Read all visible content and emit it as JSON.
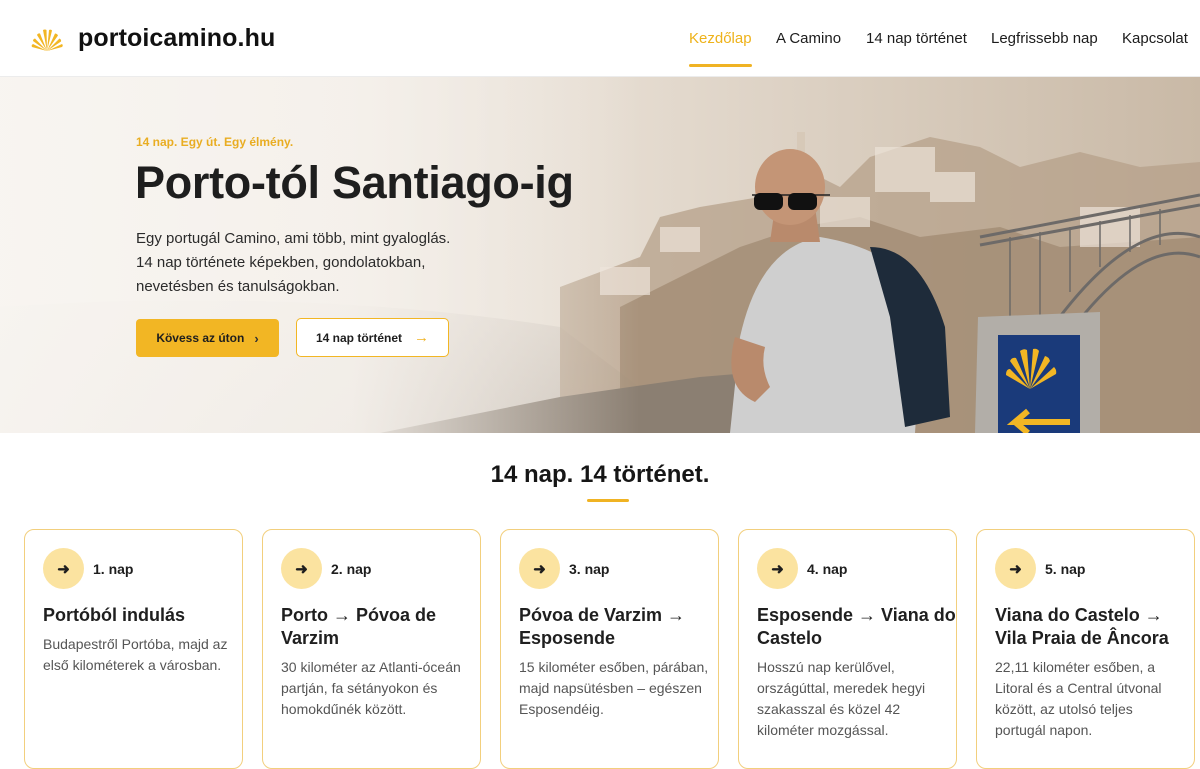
{
  "site": {
    "logo_text": "portoicamino.hu",
    "logo_icon": "scallop-shell-icon"
  },
  "nav": {
    "items": [
      {
        "label": "Kezdőlap",
        "active": true
      },
      {
        "label": "A Camino"
      },
      {
        "label": "14 nap történet"
      },
      {
        "label": "Legfrissebb nap"
      },
      {
        "label": "Kapcsolat"
      }
    ]
  },
  "hero": {
    "eyebrow": "14 nap. Egy út. Egy élmény.",
    "title": "Porto-tól Santiago-ig",
    "subtitle_lines": [
      "Egy portugál Camino, ami több, mint gyaloglás.",
      "14 nap története képekben, gondolatokban,",
      "nevetésben és tanulságokban."
    ],
    "primary_button": {
      "label": "Kövess az úton",
      "icon": "chevron-right-icon"
    },
    "secondary_button": {
      "label": "14 nap történet",
      "icon": "arrow-right-icon"
    }
  },
  "section": {
    "title": "14 nap. 14 történet."
  },
  "cards": [
    {
      "day": "1. nap",
      "title": "Portóból indulás",
      "description": "Budapestről Portóba, majd az első kilométerek a városban."
    },
    {
      "day": "2. nap",
      "title": "Porto → Póvoa de Varzim",
      "description": "30 kilométer az Atlanti-óceán partján, fa sétányokon és homokdűnék között."
    },
    {
      "day": "3. nap",
      "title": "Póvoa de Varzim → Esposende",
      "description": "15 kilométer esőben, párában, majd napsütésben – egészen Esposendéig."
    },
    {
      "day": "4. nap",
      "title": "Esposende → Viana do Castelo",
      "description": "Hosszú nap kerülővel, országúttal, meredek hegyi szakasszal és közel 42 kilométer mozgással."
    },
    {
      "day": "5. nap",
      "title": "Viana do Castelo → Vila Praia de Âncora",
      "description": "22,11 kilométer esőben, a Litoral és a Central útvonal között, az utolsó teljes portugál napon."
    }
  ],
  "colors": {
    "accent": "#f2b624",
    "accent_light": "#fbe3a0",
    "card_border": "#f2cf7d"
  }
}
